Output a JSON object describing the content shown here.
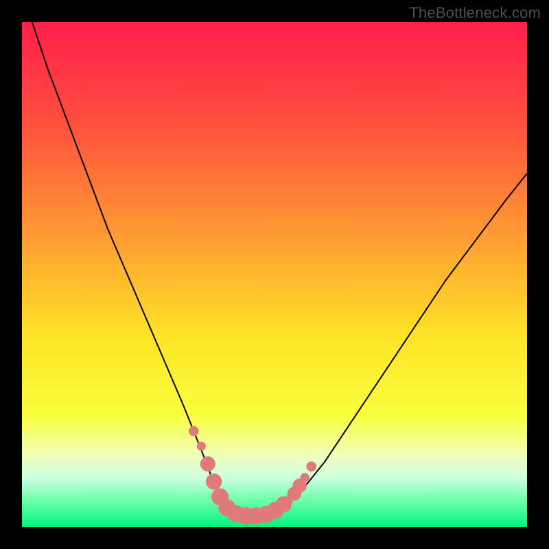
{
  "watermark": "TheBottleneck.com",
  "chart_data": {
    "type": "line",
    "title": "",
    "xlabel": "",
    "ylabel": "",
    "xlim": [
      0,
      100
    ],
    "ylim": [
      0,
      100
    ],
    "grid": false,
    "legend": false,
    "background_gradient_stops": [
      {
        "offset": 0.0,
        "color": "#ff1f4b"
      },
      {
        "offset": 0.2,
        "color": "#ff4f3e"
      },
      {
        "offset": 0.42,
        "color": "#ff9a33"
      },
      {
        "offset": 0.62,
        "color": "#ffe327"
      },
      {
        "offset": 0.78,
        "color": "#f9ff3f"
      },
      {
        "offset": 0.86,
        "color": "#f1ffbf"
      },
      {
        "offset": 0.905,
        "color": "#c8ffe0"
      },
      {
        "offset": 0.94,
        "color": "#7cffb0"
      },
      {
        "offset": 1.0,
        "color": "#02f57b"
      }
    ],
    "series": [
      {
        "name": "bottleneck-curve",
        "color": "#000000",
        "x": [
          2,
          5,
          8,
          11,
          14,
          17,
          20,
          23,
          26,
          29,
          32,
          34,
          36,
          37.5,
          39,
          40.5,
          42,
          44,
          46,
          48,
          50,
          53,
          56,
          60,
          64,
          68,
          72,
          78,
          84,
          90,
          96,
          100
        ],
        "y": [
          100,
          91,
          83,
          75,
          67,
          59,
          52,
          45,
          38,
          31,
          24,
          19,
          14,
          10,
          7,
          4.5,
          3,
          2,
          2,
          2.5,
          3.3,
          5,
          8,
          13,
          19,
          25,
          31,
          40,
          49,
          57,
          65,
          70
        ]
      }
    ],
    "markers": {
      "name": "highlight-beads",
      "color": "#e07b7b",
      "points": [
        {
          "x": 34.0,
          "y": 19.0,
          "r": 1.0
        },
        {
          "x": 35.5,
          "y": 16.0,
          "r": 0.9
        },
        {
          "x": 36.8,
          "y": 12.5,
          "r": 1.5
        },
        {
          "x": 38.0,
          "y": 9.0,
          "r": 1.6
        },
        {
          "x": 39.2,
          "y": 6.0,
          "r": 1.7
        },
        {
          "x": 40.6,
          "y": 3.8,
          "r": 1.7
        },
        {
          "x": 42.4,
          "y": 2.6,
          "r": 1.7
        },
        {
          "x": 44.4,
          "y": 2.2,
          "r": 1.7
        },
        {
          "x": 46.4,
          "y": 2.2,
          "r": 1.7
        },
        {
          "x": 48.4,
          "y": 2.5,
          "r": 1.7
        },
        {
          "x": 50.2,
          "y": 3.3,
          "r": 1.7
        },
        {
          "x": 51.8,
          "y": 4.5,
          "r": 1.6
        },
        {
          "x": 52.8,
          "y": 5.3,
          "r": 0.9
        },
        {
          "x": 53.9,
          "y": 6.6,
          "r": 1.4
        },
        {
          "x": 55.0,
          "y": 8.2,
          "r": 1.4
        },
        {
          "x": 56.0,
          "y": 9.8,
          "r": 0.9
        },
        {
          "x": 57.3,
          "y": 12.0,
          "r": 1.0
        }
      ]
    }
  }
}
